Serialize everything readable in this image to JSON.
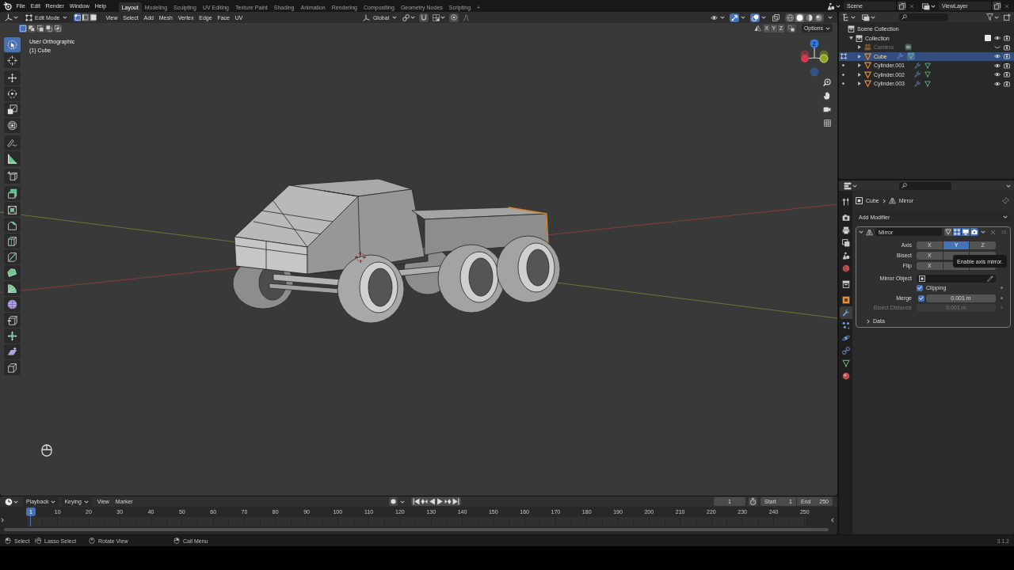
{
  "topbar": {
    "menus": [
      "File",
      "Edit",
      "Render",
      "Window",
      "Help"
    ],
    "workspaces": [
      {
        "label": "Layout",
        "selected": true
      },
      {
        "label": "Modeling",
        "selected": false
      },
      {
        "label": "Sculpting",
        "selected": false
      },
      {
        "label": "UV Editing",
        "selected": false
      },
      {
        "label": "Texture Paint",
        "selected": false
      },
      {
        "label": "Shading",
        "selected": false
      },
      {
        "label": "Animation",
        "selected": false
      },
      {
        "label": "Rendering",
        "selected": false
      },
      {
        "label": "Compositing",
        "selected": false
      },
      {
        "label": "Geometry Nodes",
        "selected": false
      },
      {
        "label": "Scripting",
        "selected": false
      }
    ],
    "add_workspace": "+",
    "scene": "Scene",
    "view_layer": "ViewLayer"
  },
  "viewport": {
    "header": {
      "mode": "Edit Mode",
      "select_modes": [
        {
          "kind": "vertex",
          "selected": true
        },
        {
          "kind": "edge",
          "selected": false
        },
        {
          "kind": "face",
          "selected": false
        }
      ],
      "menus": [
        "View",
        "Select",
        "Add",
        "Mesh",
        "Vertex",
        "Edge",
        "Face",
        "UV"
      ],
      "orientation": "Global",
      "toggles": [
        {
          "kind": "selectability",
          "on": false
        },
        {
          "kind": "gizmos",
          "on": true
        },
        {
          "kind": "overlays",
          "on": true
        },
        {
          "kind": "xray",
          "on": false
        }
      ],
      "shading": [
        {
          "kind": "wireframe",
          "selected": false
        },
        {
          "kind": "solid",
          "selected": true
        },
        {
          "kind": "material",
          "selected": false
        },
        {
          "kind": "rendered",
          "selected": false
        }
      ]
    },
    "tool_settings": {
      "select_box_modes": [
        {
          "kind": "set",
          "selected": true
        },
        {
          "kind": "extend",
          "selected": false
        },
        {
          "kind": "subtract",
          "selected": false
        },
        {
          "kind": "invert",
          "selected": false
        },
        {
          "kind": "intersect",
          "selected": false
        }
      ],
      "mirror_axes": [
        {
          "label": "X",
          "selected": false
        },
        {
          "label": "Y",
          "selected": false
        },
        {
          "label": "Z",
          "selected": false
        }
      ],
      "options": "Options"
    },
    "view_name": "User Orthographic",
    "object_label": "(1) Cube",
    "toolbar": [
      {
        "tools": [
          {
            "kind": "select_box",
            "selected": true
          },
          {
            "kind": "cursor",
            "selected": false
          }
        ]
      },
      {
        "tools": [
          {
            "kind": "move",
            "selected": false
          },
          {
            "kind": "rotate",
            "selected": false
          },
          {
            "kind": "scale",
            "selected": false
          },
          {
            "kind": "transform",
            "selected": false
          }
        ]
      },
      {
        "tools": [
          {
            "kind": "annotate",
            "selected": false
          },
          {
            "kind": "measure",
            "selected": false
          }
        ]
      },
      {
        "tools": [
          {
            "kind": "add_cube",
            "selected": false
          }
        ]
      },
      {
        "tools": [
          {
            "kind": "extrude",
            "selected": false
          },
          {
            "kind": "inset",
            "selected": false
          },
          {
            "kind": "bevel",
            "selected": false
          },
          {
            "kind": "loop_cut",
            "selected": false
          },
          {
            "kind": "knife",
            "selected": false
          },
          {
            "kind": "poly_build",
            "selected": false
          },
          {
            "kind": "spin",
            "selected": false
          },
          {
            "kind": "smooth",
            "selected": false
          },
          {
            "kind": "edge_slide",
            "selected": false
          },
          {
            "kind": "shrink",
            "selected": false
          },
          {
            "kind": "shear",
            "selected": false
          },
          {
            "kind": "rip",
            "selected": false
          }
        ]
      }
    ],
    "gizmo_axis_label": "Z"
  },
  "outliner": {
    "tree": [
      {
        "name": "Scene Collection",
        "kind": "scene_collection",
        "children": [
          {
            "name": "Collection",
            "kind": "collection",
            "expanded": true,
            "checked": true,
            "visible": true,
            "children": [
              {
                "name": "Camera",
                "kind": "camera",
                "expanded": false,
                "selected": false,
                "visible": false
              },
              {
                "name": "Cube",
                "kind": "mesh",
                "expanded": false,
                "selected": true,
                "visible": true,
                "edit_mode": true
              },
              {
                "name": "Cylinder.001",
                "kind": "mesh",
                "expanded": false,
                "selected": false,
                "visible": true,
                "edit_mode": false
              },
              {
                "name": "Cylinder.002",
                "kind": "mesh",
                "expanded": false,
                "selected": false,
                "visible": true,
                "edit_mode": false
              },
              {
                "name": "Cylinder.003",
                "kind": "mesh",
                "expanded": false,
                "selected": false,
                "visible": true,
                "edit_mode": false
              }
            ]
          }
        ]
      }
    ]
  },
  "properties": {
    "tab_groups": [
      {
        "tabs": [
          {
            "kind": "tool",
            "selected": false
          }
        ]
      },
      {
        "tabs": [
          {
            "kind": "render",
            "selected": false
          },
          {
            "kind": "output",
            "selected": false
          },
          {
            "kind": "view_layer",
            "selected": false
          },
          {
            "kind": "scene",
            "selected": false
          },
          {
            "kind": "world",
            "selected": false
          }
        ]
      },
      {
        "tabs": [
          {
            "kind": "collection",
            "selected": false
          }
        ]
      },
      {
        "tabs": [
          {
            "kind": "object",
            "selected": false
          },
          {
            "kind": "modifiers",
            "selected": true
          },
          {
            "kind": "particles",
            "selected": false
          },
          {
            "kind": "physics",
            "selected": false
          },
          {
            "kind": "constraints",
            "selected": false
          },
          {
            "kind": "data",
            "selected": false
          },
          {
            "kind": "material",
            "selected": false
          }
        ]
      }
    ],
    "breadcrumb": [
      {
        "label": "Cube",
        "kind": "object"
      },
      {
        "label": "Mirror",
        "kind": "modifier"
      }
    ],
    "add_modifier": "Add Modifier",
    "modifier": {
      "name": "Mirror",
      "expanded": true,
      "toggles": [
        {
          "kind": "cage",
          "on": false
        },
        {
          "kind": "edit_mode",
          "on": true
        },
        {
          "kind": "viewport",
          "on": true
        },
        {
          "kind": "render",
          "on": true
        }
      ],
      "axis_rows": [
        {
          "label": "Axis",
          "buttons": [
            {
              "label": "X",
              "selected": false
            },
            {
              "label": "Y",
              "selected": true
            },
            {
              "label": "Z",
              "selected": false
            }
          ]
        },
        {
          "label": "Bisect",
          "buttons": [
            {
              "label": "X",
              "selected": false
            }
          ]
        },
        {
          "label": "Flip",
          "buttons": [
            {
              "label": "X",
              "selected": false
            }
          ]
        }
      ],
      "tooltip": "Enable axis mirror.",
      "mirror_object_label": "Mirror Object",
      "clipping": {
        "label": "Clipping",
        "checked": true
      },
      "merge": {
        "label": "Merge",
        "checked": true,
        "value": "0.001 m"
      },
      "bisect_distance": {
        "label": "Bisect Distance",
        "value": "0.001 m",
        "disabled": true
      },
      "subpanels": [
        {
          "label": "Data",
          "expanded": false
        }
      ]
    }
  },
  "timeline": {
    "menus": [
      {
        "label": "Playback",
        "kind": "dropdown"
      },
      {
        "label": "Keying",
        "kind": "dropdown"
      },
      {
        "label": "View",
        "kind": "menu"
      },
      {
        "label": "Marker",
        "kind": "menu"
      }
    ],
    "current_frame": "1",
    "start_label": "Start",
    "start": "1",
    "end_label": "End",
    "end": "250",
    "playhead": "1",
    "ruler": [
      "10",
      "20",
      "30",
      "40",
      "50",
      "60",
      "70",
      "80",
      "90",
      "100",
      "110",
      "120",
      "130",
      "140",
      "150",
      "160",
      "170",
      "180",
      "190",
      "200",
      "210",
      "220",
      "230",
      "240",
      "250"
    ]
  },
  "status_bar": {
    "hints": [
      {
        "label": "Select",
        "kind": "left"
      },
      {
        "label": "Lasso Select",
        "kind": "left_drag"
      },
      {
        "label": "Rotate View",
        "kind": "middle"
      },
      {
        "label": "Call Menu",
        "kind": "right"
      }
    ],
    "version": "3.1.2"
  }
}
